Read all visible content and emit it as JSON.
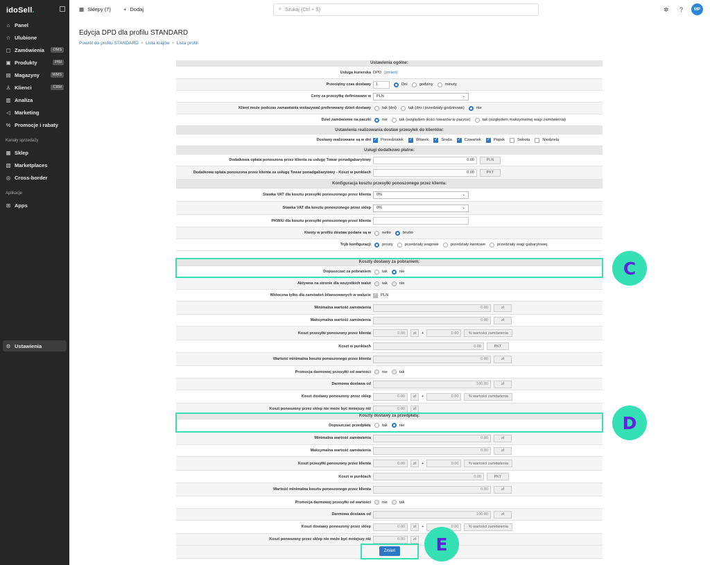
{
  "sidebar": {
    "logo": "idoSell",
    "logo_dot": ".",
    "items": [
      {
        "label": "Panel",
        "icon": "home-icon",
        "glyph": "⌂"
      },
      {
        "label": "Ulubione",
        "icon": "star-icon",
        "glyph": "☆"
      },
      {
        "label": "Zamówienia",
        "icon": "orders-icon",
        "glyph": "▢",
        "badge": "OMS"
      },
      {
        "label": "Produkty",
        "icon": "products-icon",
        "glyph": "▣",
        "badge": "PIM"
      },
      {
        "label": "Magazyny",
        "icon": "warehouse-icon",
        "glyph": "▤",
        "badge": "WMS"
      },
      {
        "label": "Klienci",
        "icon": "clients-icon",
        "glyph": "♙",
        "badge": "CRM"
      },
      {
        "label": "Analiza",
        "icon": "chart-icon",
        "glyph": "▥"
      },
      {
        "label": "Marketing",
        "icon": "megaphone-icon",
        "glyph": "◁"
      },
      {
        "label": "Promocje i rabaty",
        "icon": "percent-icon",
        "glyph": "%"
      }
    ],
    "section_sales": "Kanały sprzedaży",
    "sales": [
      {
        "label": "Sklep",
        "icon": "shop-icon",
        "glyph": "▦"
      },
      {
        "label": "Marketplaces",
        "icon": "marketplace-icon",
        "glyph": "▧"
      },
      {
        "label": "Cross-border",
        "icon": "globe-icon",
        "glyph": "◎"
      }
    ],
    "section_apps": "Aplikacje",
    "apps": [
      {
        "label": "Apps",
        "icon": "apps-icon",
        "glyph": "⊞"
      }
    ],
    "settings": {
      "label": "Ustawienia",
      "icon": "gear-icon",
      "glyph": "⚙"
    }
  },
  "topbar": {
    "shops": "Sklepy (7)",
    "add": "Dodaj",
    "search_placeholder": "Szukaj (Ctrl + S)",
    "avatar": "MP"
  },
  "page": {
    "title": "Edycja DPD dla profilu STANDARD",
    "crumbs": [
      "Powrót do profilu STANDARD",
      "Lista krajów",
      "Lista profili"
    ]
  },
  "general": {
    "header": "Ustawienia ogólne:",
    "courier_label": "Usługa kurierska",
    "courier_value": "DPD",
    "courier_change": "[zmień]",
    "delivery_time_label": "Przeciętny czas dostawy",
    "delivery_time_value": "1",
    "delivery_units": [
      "Dni",
      "godziny",
      "minuty"
    ],
    "prices_label": "Ceny za przesyłkę definiowane w",
    "prices_value": "PLN",
    "pref_day_label": "Klient może podczas zamawiania wskazywać preferowany dzień dostawy",
    "pref_day_options": [
      "tak (dni)",
      "tak (dni i przedziały godzinowe)",
      "nie"
    ],
    "split_label": "Dziel zamówienie na paczki",
    "split_options": [
      "nie",
      "tak (względem ilości towarów w paczce)",
      "tak (względem maksymalnej wagi zamówienia)"
    ]
  },
  "days": {
    "header": "Ustawienia realizowania dostaw przesyłek do klientów:",
    "label": "Dostawy realizowane są w dni",
    "list": [
      {
        "name": "Poniedziałek",
        "checked": true
      },
      {
        "name": "Wtorek",
        "checked": true
      },
      {
        "name": "Środa",
        "checked": true
      },
      {
        "name": "Czwartek",
        "checked": true
      },
      {
        "name": "Piątek",
        "checked": true
      },
      {
        "name": "Sobota",
        "checked": false
      },
      {
        "name": "Niedziela",
        "checked": false
      }
    ]
  },
  "extra": {
    "header": "Usługi dodatkowo płatne:",
    "fee_label": "Dodatkowa opłata ponoszona przez klienta za usługę Towar ponadgabarytowy",
    "fee_value": "0.00",
    "fee_unit": "PLN",
    "points_label": "Dodatkowa opłata ponoszona przez klienta za usługę Towar ponadgabarytowy - Koszt w punktach",
    "points_value": "0.00",
    "points_unit": "PKT"
  },
  "config": {
    "header": "Konfiguracja kosztu przesyłki ponoszonego przez klienta:",
    "vat_client_label": "Stawka VAT dla kosztu przesyłki ponoszonego przez klienta",
    "vat_client_value": "0%",
    "vat_shop_label": "Stawka VAT dla kosztu ponoszonego przez sklep",
    "vat_shop_value": "0%",
    "pkwiu_label": "PKWiU dla kosztu przesyłki ponoszonego przez klienta",
    "pkwiu_value": "",
    "amounts_label": "Kwoty w profilu dostaw podane są w",
    "amounts_options": [
      "netto",
      "brutto"
    ],
    "mode_label": "Tryb konfiguracji",
    "mode_options": [
      "prosty",
      "przedziały wagowe",
      "przedziały kwotowe",
      "przedziały wagi gabarytowej"
    ]
  },
  "cod": {
    "header": "Koszty dostawy za pobraniem:",
    "allow_label": "Dopuszczać za pobraniem",
    "active_label": "Aktywna na stronie dla wszystkich walut",
    "visible_label": "Widoczna tylko dla zamówień bilansowanych w walucie",
    "visible_currency": "PLN",
    "yes": "tak",
    "no": "nie"
  },
  "fields": {
    "min_order": "Minimalna wartość zamówienia",
    "max_order": "Maksymalna wartość zamówienia",
    "client_cost": "Koszt przesyłki ponoszony przez klienta",
    "points_cost": "Koszt w punktach",
    "min_client_cost": "Wartość minimalna kosztu ponoszonego przez klienta",
    "free_promo": "Promocja darmowej przesyłki od wartości",
    "free_from": "Darmowa dostawa od",
    "shop_cost": "Koszt dostawy ponoszony przez sklep",
    "shop_min": "Koszt ponoszony przez sklep nie może być mniejszy niż",
    "zero": "0.00",
    "hundred": "100.00",
    "zl": "zł",
    "pkt": "PKT",
    "plus": "+",
    "pct_of_order": "% wartości zamówienia"
  },
  "prepaid": {
    "header": "Koszty dostawy za przedpłatą:",
    "allow_label": "Dopuszczać przedpłatę"
  },
  "submit": "Zmień",
  "annotations": {
    "c": "C",
    "d": "D",
    "e": "E"
  },
  "colors": {
    "accent": "#2b78c6",
    "highlight": "#35e0b5",
    "badge_text": "#5b26d9",
    "sidebar": "#262626"
  }
}
